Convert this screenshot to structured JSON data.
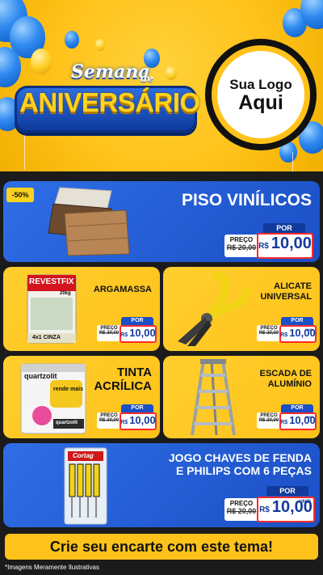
{
  "header": {
    "title_top": "Semana",
    "title_de": "de",
    "title_main": "ANIVERSÁRIO",
    "logo_line1": "Sua Logo",
    "logo_line2": "Aqui"
  },
  "badge": "-50%",
  "products": [
    {
      "name": "PISO VINÍLICOS",
      "por": "POR",
      "label": "PREÇO",
      "old_price": "R$ 20,00",
      "currency": "R$",
      "price": "10,00",
      "unit": ""
    },
    {
      "name": "ARGAMASSA",
      "por": "POR",
      "label": "PREÇO",
      "old_price": "R$ 20,00",
      "currency": "R$",
      "price": "10,00",
      "unit": ""
    },
    {
      "name_line1": "ALICATE",
      "name_line2": "UNIVERSAL",
      "por": "POR",
      "label": "PREÇO",
      "old_price": "R$ 20,00",
      "currency": "R$",
      "price": "10,00",
      "unit": "UNID"
    },
    {
      "name_line1": "TINTA",
      "name_line2": "ACRÍLICA",
      "por": "POR",
      "label": "PREÇO",
      "old_price": "R$ 20,00",
      "currency": "R$",
      "price": "10,00",
      "unit": ""
    },
    {
      "name_line1": "ESCADA DE",
      "name_line2": "ALUMÍNIO",
      "por": "POR",
      "label": "PREÇO",
      "old_price": "R$ 20,00",
      "currency": "R$",
      "price": "10,00",
      "unit": "UNID"
    },
    {
      "name_line1": "JOGO CHAVES DE FENDA",
      "name_line2": "E PHILIPS COM 6 PEÇAS",
      "por": "POR",
      "label": "PREÇO",
      "old_price": "R$ 20,00",
      "currency": "R$",
      "price": "10,00",
      "unit": "UNID"
    }
  ],
  "package_texts": {
    "revestfix": "REVESTFIX",
    "revestfix_weight": "20kg",
    "revestfix_type": "4x1 CINZA",
    "quartzolit": "quartzolit",
    "rende_mais": "rende mais",
    "cortag": "Cortag"
  },
  "footer": {
    "cta": "Crie seu encarte com este tema!",
    "disclaimer": "*Imagens Meramente Ilustrativas"
  },
  "colors": {
    "yellow": "#ffc21a",
    "blue": "#1b4fc5",
    "price_blue": "#123a9c"
  }
}
